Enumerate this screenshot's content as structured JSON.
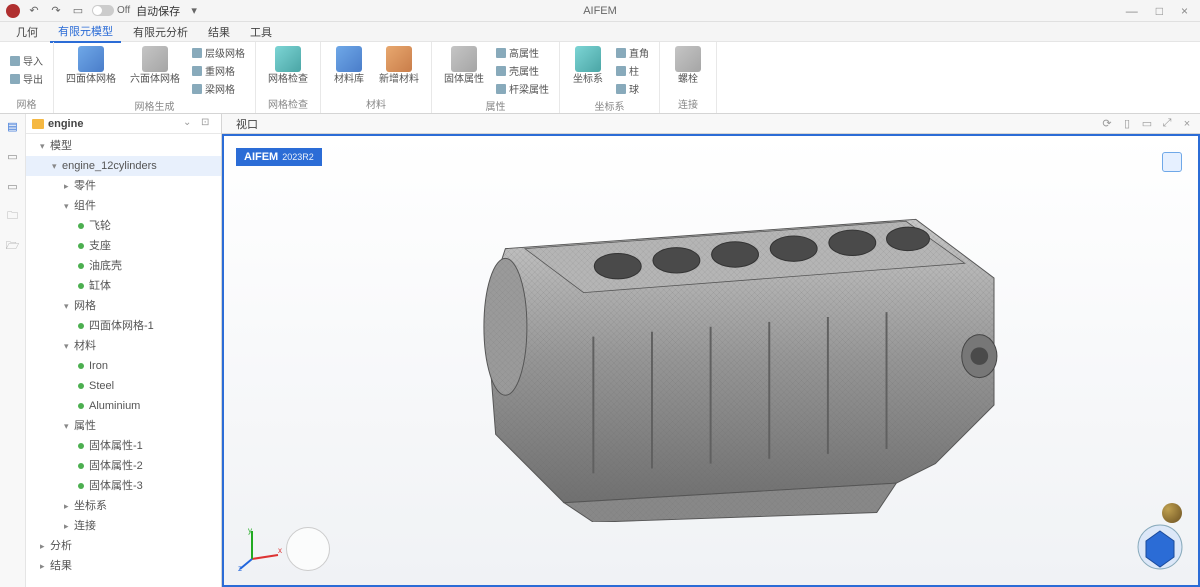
{
  "titlebar": {
    "autosave_label": "自动保存",
    "switch_state": "Off",
    "app_title": "AIFEM"
  },
  "window_controls": {
    "min": "—",
    "max": "□",
    "close": "×"
  },
  "menubar": {
    "items": [
      "几何",
      "有限元模型",
      "有限元分析",
      "结果",
      "工具"
    ],
    "active_index": 1
  },
  "ribbon": {
    "group0": {
      "label": "网格",
      "import": "导入",
      "export": "导出"
    },
    "group1": {
      "label": "网格生成",
      "tet": "四面体网格",
      "hex": "六面体网格",
      "layer": "层级网格",
      "remesh": "重网格",
      "beam": "梁网格"
    },
    "group2": {
      "label": "网格检查",
      "check": "网格检查"
    },
    "group3": {
      "label": "材料",
      "lib": "材料库",
      "new": "新增材料"
    },
    "group4": {
      "label": "属性",
      "solid": "固体属性",
      "high": "高属性",
      "shell": "壳属性",
      "member": "杆梁属性"
    },
    "group5": {
      "label": "坐标系",
      "cs": "坐标系",
      "rect": "直角",
      "cyl": "柱",
      "sph": "球"
    },
    "group6": {
      "label": "连接",
      "conn": "螺栓"
    }
  },
  "tree": {
    "root": "engine",
    "nodes": {
      "model": "模型",
      "engine_cyl": "engine_12cylinders",
      "parts": "零件",
      "assembly": "组件",
      "flywheel": "飞轮",
      "support": "支座",
      "oilpan": "油底壳",
      "block": "缸体",
      "mesh": "网格",
      "tet1": "四面体网格-1",
      "material": "材料",
      "iron": "Iron",
      "steel": "Steel",
      "alum": "Aluminium",
      "property": "属性",
      "solid1": "固体属性-1",
      "solid2": "固体属性-2",
      "solid3": "固体属性-3",
      "cs": "坐标系",
      "connection": "连接"
    },
    "bottom": {
      "analysis": "分析",
      "results": "结果"
    }
  },
  "viewport": {
    "tab": "视口",
    "watermark": "AIFEM",
    "version": "2023R2"
  }
}
